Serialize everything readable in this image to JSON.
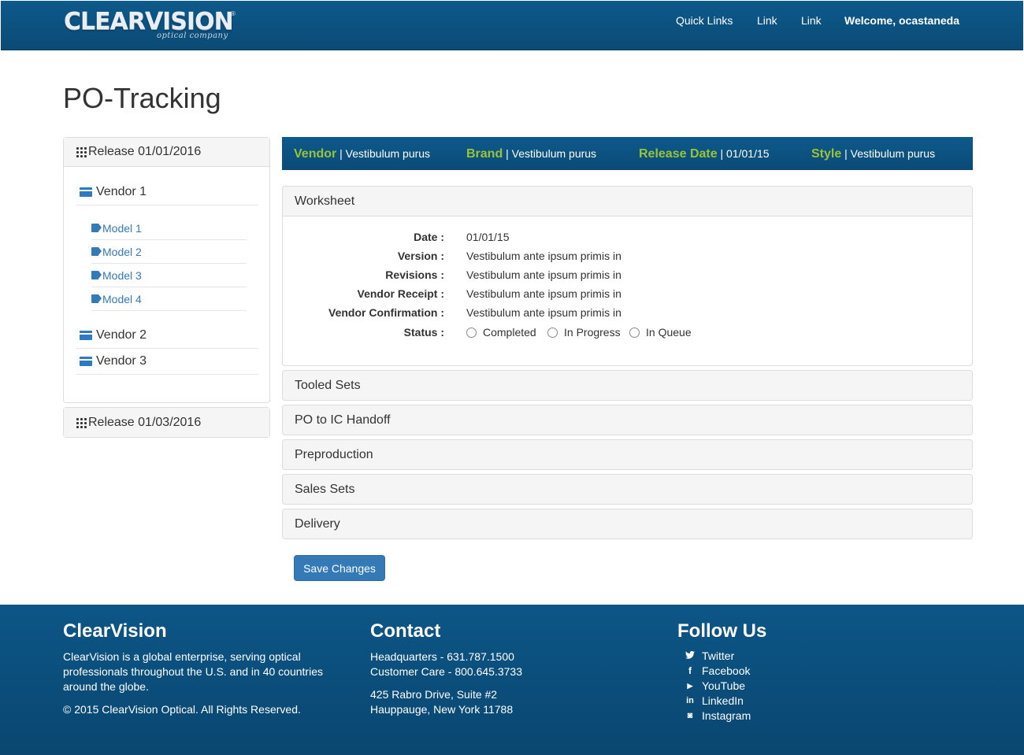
{
  "header": {
    "logo_text": "CLEARVISION",
    "logo_reg": "®",
    "logo_subtitle": "optical company",
    "nav": [
      "Quick Links",
      "Link",
      "Link"
    ],
    "welcome": "Welcome, ocastaneda"
  },
  "page_title": "PO-Tracking",
  "sidebar": {
    "release1": {
      "label": "Release 01/01/2016",
      "vendors": [
        {
          "label": "Vendor 1",
          "models": [
            "Model 1",
            "Model 2",
            "Model 3",
            "Model 4"
          ]
        },
        {
          "label": "Vendor 2"
        },
        {
          "label": "Vendor 3"
        }
      ]
    },
    "release2": {
      "label": "Release 01/03/2016"
    }
  },
  "infobar": [
    {
      "key": "Vendor",
      "value": "Vestibulum purus"
    },
    {
      "key": "Brand",
      "value": "Vestibulum purus"
    },
    {
      "key": "Release Date",
      "value": "01/01/15"
    },
    {
      "key": "Style",
      "value": "Vestibulum purus"
    }
  ],
  "worksheet": {
    "title": "Worksheet",
    "fields": [
      {
        "label": "Date :",
        "value": "01/01/15"
      },
      {
        "label": "Version :",
        "value": "Vestibulum ante ipsum primis in"
      },
      {
        "label": "Revisions :",
        "value": "Vestibulum ante ipsum primis in"
      },
      {
        "label": "Vendor Receipt :",
        "value": "Vestibulum ante ipsum primis in"
      },
      {
        "label": "Vendor Confirmation :",
        "value": "Vestibulum ante ipsum primis in"
      }
    ],
    "status_label": "Status :",
    "status_options": [
      "Completed",
      "In Progress",
      "In Queue"
    ]
  },
  "sections": [
    "Tooled Sets",
    "PO to IC Handoff",
    "Preproduction",
    "Sales Sets",
    "Delivery"
  ],
  "save_button": "Save Changes",
  "footer": {
    "about": {
      "title": "ClearVision",
      "lines": [
        "ClearVision is a global enterprise, serving optical",
        "professionals throughout the U.S. and in 40 countries",
        "around the globe."
      ],
      "copyright": "© 2015 ClearVision Optical. All Rights Reserved."
    },
    "contact": {
      "title": "Contact",
      "headquarters": "Headquarters - 631.787.1500",
      "customer_care": "Customer Care - 800.645.3733",
      "address1": "425 Rabro Drive, Suite #2",
      "address2": "Hauppauge, New York 11788"
    },
    "follow": {
      "title": "Follow Us",
      "links": [
        {
          "icon": "twitter-icon",
          "glyph": "🐦",
          "label": "Twitter"
        },
        {
          "icon": "facebook-icon",
          "glyph": "f",
          "label": "Facebook"
        },
        {
          "icon": "youtube-icon",
          "glyph": "▶",
          "label": "YouTube"
        },
        {
          "icon": "linkedin-icon",
          "glyph": "in",
          "label": "LinkedIn"
        },
        {
          "icon": "instagram-icon",
          "glyph": "◙",
          "label": "Instagram"
        }
      ]
    }
  },
  "colors": {
    "brand_blue": "#0b4f7e",
    "accent_green": "#99c338",
    "link_blue": "#337ab7"
  }
}
